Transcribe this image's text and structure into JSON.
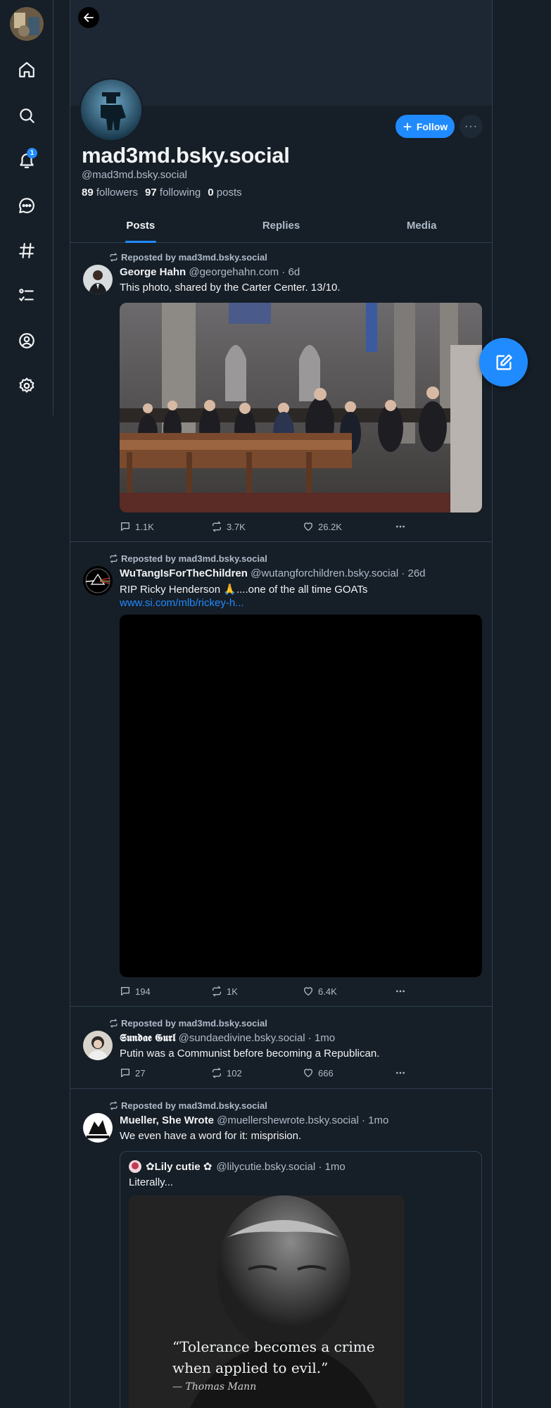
{
  "nav": {
    "notifications_badge": "1",
    "items": [
      "home-icon",
      "search-icon",
      "bell-icon",
      "chat-icon",
      "hashtag-icon",
      "list-icon",
      "profile-icon",
      "gear-icon"
    ]
  },
  "profile": {
    "display_name": "mad3md.bsky.social",
    "handle": "@mad3md.bsky.social",
    "followers_count": "89",
    "followers_label": "followers",
    "following_count": "97",
    "following_label": "following",
    "posts_count": "0",
    "posts_label": "posts",
    "follow_label": "Follow",
    "more_label": "···"
  },
  "tabs": [
    {
      "label": "Posts",
      "active": true
    },
    {
      "label": "Replies",
      "active": false
    },
    {
      "label": "Media",
      "active": false
    }
  ],
  "posts": [
    {
      "repost_label": "Reposted by mad3md.bsky.social",
      "author": "George Hahn",
      "meta": "@georgehahn.com · 6d",
      "text": "This photo, shared by the Carter Center. 13/10.",
      "replies": "1.1K",
      "reposts": "3.7K",
      "likes": "26.2K"
    },
    {
      "repost_label": "Reposted by mad3md.bsky.social",
      "author": "WuTangIsForTheChildren",
      "meta": "@wutangforchildren.bsky.social · 26d",
      "text": "RIP Ricky Henderson 🙏....one of the all time GOATs",
      "link": "www.si.com/mlb/rickey-h...",
      "replies": "194",
      "reposts": "1K",
      "likes": "6.4K"
    },
    {
      "repost_label": "Reposted by mad3md.bsky.social",
      "author": "𝕾𝖚𝖓𝖉𝖆𝖊 𝕲𝖚𝖗𝖑",
      "meta": "@sundaedivine.bsky.social · 1mo",
      "text": "Putin was a Communist before becoming a Republican.",
      "replies": "27",
      "reposts": "102",
      "likes": "666"
    },
    {
      "repost_label": "Reposted by mad3md.bsky.social",
      "author": "Mueller, She Wrote",
      "meta": "@muellershewrote.bsky.social · 1mo",
      "text": "We even have a word for it: misprision.",
      "quote": {
        "author": "✿Lily cutie ✿",
        "meta": "@lilycutie.bsky.social · 1mo",
        "text": "Literally...",
        "image_quote": "“Tolerance becomes a crime when applied to evil.”",
        "image_attribution": "— Thomas Mann"
      }
    }
  ],
  "colors": {
    "background": "#161e27",
    "accent": "#208bfe",
    "border": "#2e4052",
    "muted": "#aebbc9"
  }
}
